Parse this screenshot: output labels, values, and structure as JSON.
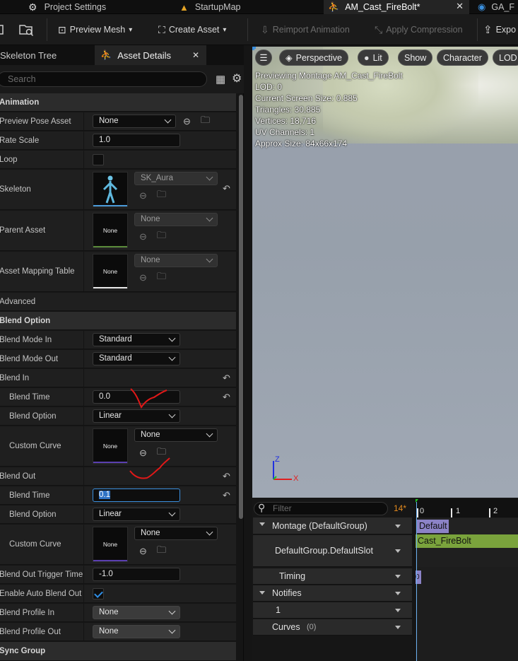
{
  "tabs": [
    {
      "label": "Project Settings",
      "icon": "gear-icon"
    },
    {
      "label": "StartupMap",
      "icon": "map-icon"
    },
    {
      "label": "AM_Cast_FireBolt*",
      "icon": "montage-icon"
    },
    {
      "label": "GA_F",
      "icon": "blueprint-icon"
    }
  ],
  "toolbar": {
    "preview_mesh": "Preview Mesh",
    "create_asset": "Create Asset",
    "reimport": "Reimport Animation",
    "apply_compression": "Apply Compression",
    "export": "Expo"
  },
  "panel": {
    "tab_skeleton": "Skeleton Tree",
    "tab_details": "Asset Details",
    "search_placeholder": "Search"
  },
  "details": {
    "cat_animation": "Animation",
    "preview_pose_asset": {
      "label": "Preview Pose Asset",
      "value": "None"
    },
    "rate_scale": {
      "label": "Rate Scale",
      "value": "1.0"
    },
    "loop": {
      "label": "Loop",
      "checked": false
    },
    "skeleton": {
      "label": "Skeleton",
      "value": "SK_Aura"
    },
    "parent_asset": {
      "label": "Parent Asset",
      "thumb": "None",
      "value": "None"
    },
    "asset_mapping_table": {
      "label": "Asset Mapping Table",
      "thumb": "None",
      "value": "None"
    },
    "advanced": "Advanced",
    "cat_blend_option": "Blend Option",
    "blend_mode_in": {
      "label": "Blend Mode In",
      "value": "Standard"
    },
    "blend_mode_out": {
      "label": "Blend Mode Out",
      "value": "Standard"
    },
    "blend_in": {
      "label": "Blend In",
      "blend_time": {
        "label": "Blend Time",
        "value": "0.0"
      },
      "blend_option": {
        "label": "Blend Option",
        "value": "Linear"
      },
      "custom_curve": {
        "label": "Custom Curve",
        "thumb": "None",
        "value": "None"
      }
    },
    "blend_out": {
      "label": "Blend Out",
      "blend_time": {
        "label": "Blend Time",
        "value": "0.1"
      },
      "blend_option": {
        "label": "Blend Option",
        "value": "Linear"
      },
      "custom_curve": {
        "label": "Custom Curve",
        "thumb": "None",
        "value": "None"
      }
    },
    "blend_out_trigger_time": {
      "label": "Blend Out Trigger Time",
      "value": "-1.0"
    },
    "enable_auto_blend_out": {
      "label": "Enable Auto Blend Out",
      "checked": true
    },
    "blend_profile_in": {
      "label": "Blend Profile In",
      "value": "None"
    },
    "blend_profile_out": {
      "label": "Blend Profile Out",
      "value": "None"
    },
    "cat_sync_group": "Sync Group"
  },
  "viewport": {
    "perspective": "Perspective",
    "lit": "Lit",
    "show": "Show",
    "character": "Character",
    "lod": "LOD",
    "info": [
      "Previewing Montage AM_Cast_FireBolt",
      "LOD: 0",
      "Current Screen Size: 0.885",
      "Triangles: 30,885",
      "Vertices: 18,716",
      "UV Channels: 1",
      "Approx Size: 84x66x174"
    ],
    "axis_z": "Z",
    "axis_x": "X"
  },
  "timeline": {
    "filter_placeholder": "Filter",
    "count": "14*",
    "ruler": [
      "0",
      "1",
      "2"
    ],
    "montage": "Montage (DefaultGroup)",
    "slot": "DefaultGroup.DefaultSlot",
    "timing": "Timing",
    "notifies": "Notifies",
    "notify_track": "1",
    "curves": "Curves",
    "curves_count": "(0)",
    "section_default": "Default",
    "segment_name": "Cast_FireBolt",
    "timing_marker": "0"
  },
  "colors": {
    "accent": "#3a8fde",
    "segment_green": "#7aa33c",
    "section_purple": "#8c83c7",
    "annotation_red": "#e01818"
  }
}
